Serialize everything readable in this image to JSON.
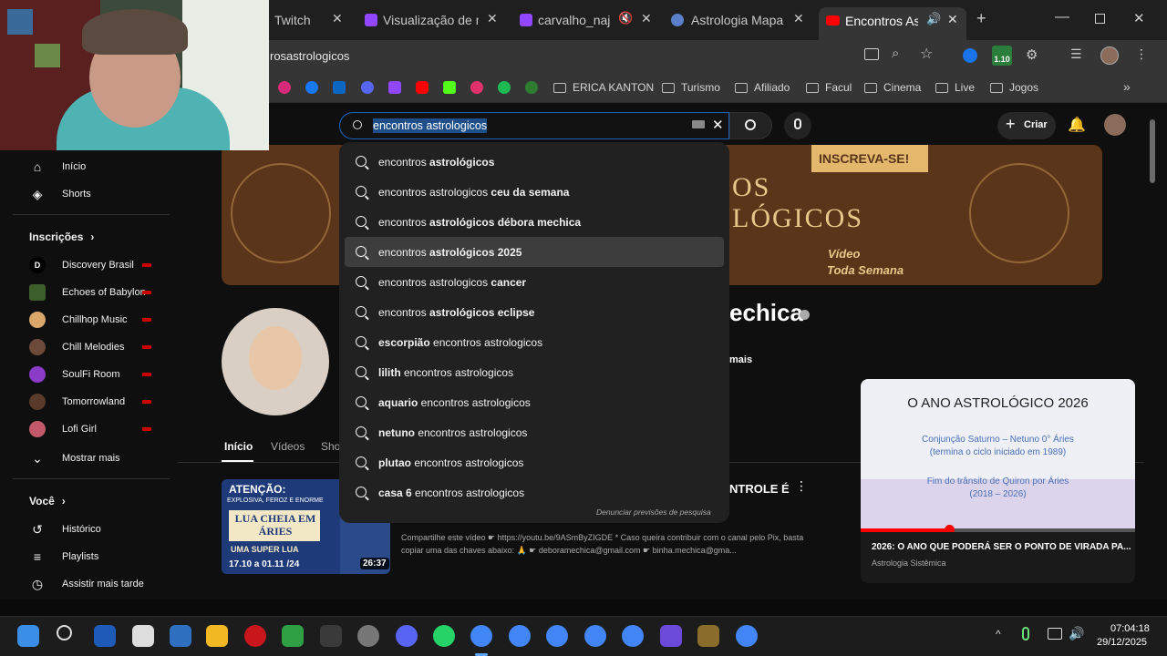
{
  "browser": {
    "tabs": [
      {
        "label": "Twitch"
      },
      {
        "label": "Visualização de mo"
      },
      {
        "label": "carvalho_najas"
      },
      {
        "label": "Astrologia Mapa Gr"
      },
      {
        "label": "Encontros Astro"
      }
    ],
    "url": "rosastrologicos",
    "bookmarks": [
      "ERICA KANTON",
      "Turismo",
      "Afiliado",
      "Facul",
      "Cinema",
      "Live",
      "Jogos"
    ],
    "extension_badge": "1.10"
  },
  "youtube": {
    "search_value": "encontros astrologicos",
    "create_label": "Criar",
    "sidebar": {
      "top": [
        {
          "label": "Início",
          "icon": "home-icon"
        },
        {
          "label": "Shorts",
          "icon": "shorts-icon"
        }
      ],
      "subscriptions_title": "Inscrições",
      "subscriptions": [
        {
          "label": "Discovery Brasil",
          "color": "#000000"
        },
        {
          "label": "Echoes of Babylon",
          "color": "#3b5e2b"
        },
        {
          "label": "Chillhop Music",
          "color": "#d9a66b"
        },
        {
          "label": "Chill Melodies",
          "color": "#6b4a3a"
        },
        {
          "label": "SoulFi Room",
          "color": "#8a3cc9"
        },
        {
          "label": "Tomorrowland",
          "color": "#5a3a2a"
        },
        {
          "label": "Lofi Girl",
          "color": "#c35a6b"
        }
      ],
      "show_more": "Mostrar mais",
      "you_title": "Você",
      "you_items": [
        {
          "label": "Histórico",
          "icon": "history-icon"
        },
        {
          "label": "Playlists",
          "icon": "playlists-icon"
        },
        {
          "label": "Assistir mais tarde",
          "icon": "watch-later-icon"
        }
      ]
    },
    "suggestions": [
      {
        "normal": "encontros ",
        "bold": "astrológicos",
        "after": ""
      },
      {
        "normal": "encontros astrologicos ",
        "bold": "ceu da semana",
        "after": ""
      },
      {
        "normal": "encontros ",
        "bold": "astrológicos débora mechica",
        "after": ""
      },
      {
        "normal": "encontros ",
        "bold": "astrológicos 2025",
        "after": ""
      },
      {
        "normal": "encontros astrologicos ",
        "bold": "cancer",
        "after": ""
      },
      {
        "normal": "encontros ",
        "bold": "astrológicos eclipse",
        "after": ""
      },
      {
        "normal": "",
        "bold": "escorpião",
        "after": " encontros astrologicos"
      },
      {
        "normal": "",
        "bold": "lilith",
        "after": " encontros astrologicos"
      },
      {
        "normal": "",
        "bold": "aquario",
        "after": " encontros astrologicos"
      },
      {
        "normal": "",
        "bold": "netuno",
        "after": " encontros astrologicos"
      },
      {
        "normal": "",
        "bold": "plutao",
        "after": " encontros astrologicos"
      },
      {
        "normal": "",
        "bold": "casa 6",
        "after": " encontros astrologicos"
      }
    ],
    "report_predictions": "Denunciar previsões de pesquisa",
    "banner": {
      "subscribe": "INSCREVA-SE!",
      "right_text_1": "OS",
      "right_text_2": "LÓGICOS",
      "tag_1": "Vídeo",
      "tag_2": "Toda Semana"
    },
    "channel_name_fragment": "echica",
    "more_fragment": "mais",
    "tabs": [
      "Início",
      "Vídeos",
      "Sho"
    ],
    "video1": {
      "thumb_top": "ATENÇÃO:",
      "thumb_sub": "EXPLOSIVA, FEROZ E ENORME",
      "thumb_mid": "LUA CHEIA EM ÁRIES",
      "thumb_bottom": "UMA SUPER LUA",
      "thumb_dates": "17.10 a 01.11 /24",
      "duration": "26:37",
      "title_fragment": "NTROLE É",
      "desc_1": "Compartilhe este vídeo ☛ https://youtu.be/9ASmByZIGDE * Caso queira contribuir com o canal pelo Pix, basta",
      "desc_2": "copiar uma das chaves abaixo: 🙏 ☛ deboramechica@gmail.com ☛ binha.mechica@gma..."
    },
    "featured": {
      "thumb_title": "O ANO ASTROLÓGICO 2026",
      "line_1": "Conjunção Saturno – Netuno   0° Áries",
      "line_2": "(termina o ciclo iniciado em 1989)",
      "line_3": "Fim do trânsito de Quiron por Áries",
      "line_4": "(2018 – 2026)",
      "title": "2026: O ANO QUE PODERÁ SER O PONTO DE VIRADA PA...",
      "channel": "Astrologia Sistêmica"
    }
  },
  "taskbar": {
    "time": "07:04:18",
    "date": "29/12/2025"
  }
}
